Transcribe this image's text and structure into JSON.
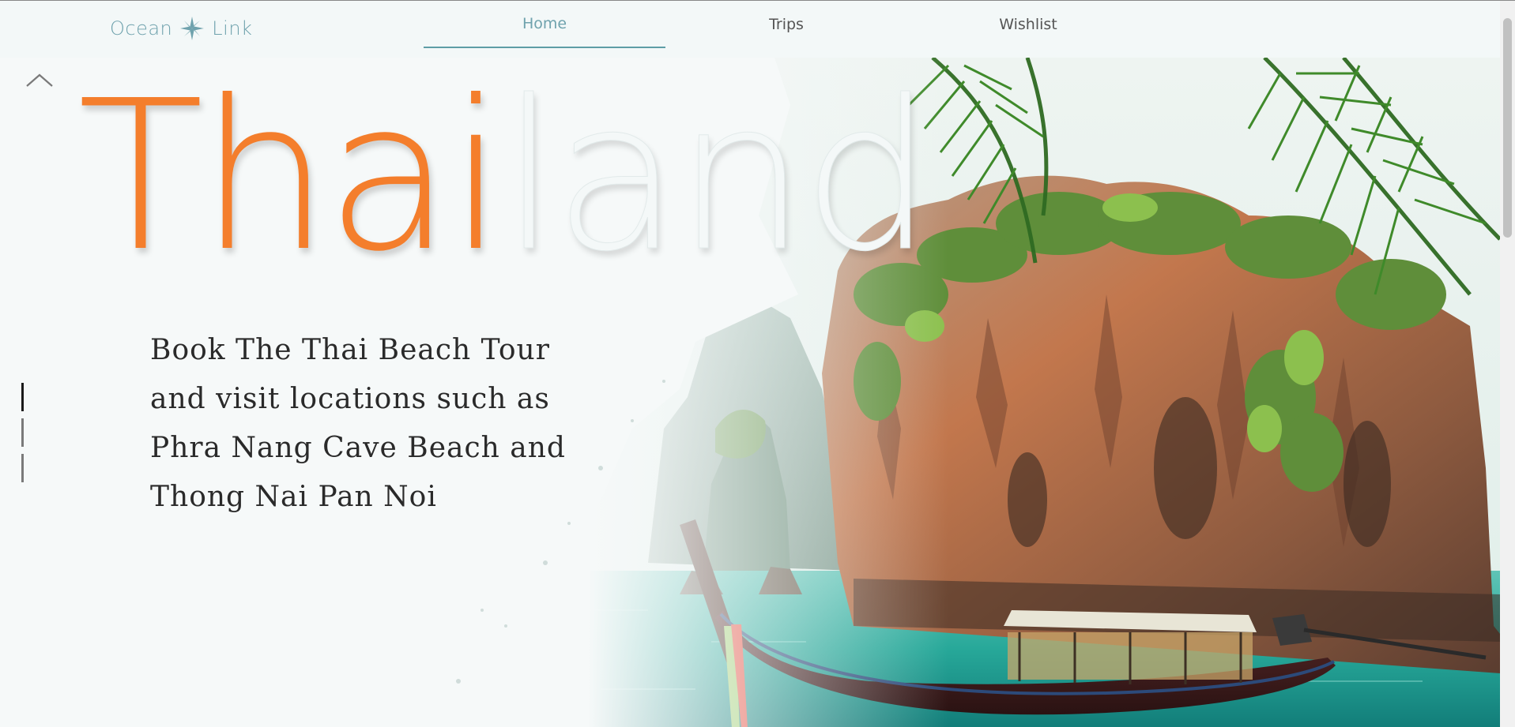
{
  "brand": {
    "name_left": "Ocean",
    "name_right": "Link",
    "icon": "compass-star-icon",
    "color": "#6fa2ad"
  },
  "nav": {
    "items": [
      {
        "label": "Home",
        "active": true
      },
      {
        "label": "Trips",
        "active": false
      },
      {
        "label": "Wishlist",
        "active": false
      }
    ]
  },
  "hero": {
    "title_highlight": "Thai",
    "title_rest": "land",
    "title_highlight_color": "#f47e2c",
    "description": "Book The Thai Beach Tour and visit locations such as Phra Nang Cave Beach and Thong Nai Pan Noi",
    "scroll_icon": "chevron-up-icon",
    "slides": {
      "count": 3,
      "active_index": 0
    }
  }
}
